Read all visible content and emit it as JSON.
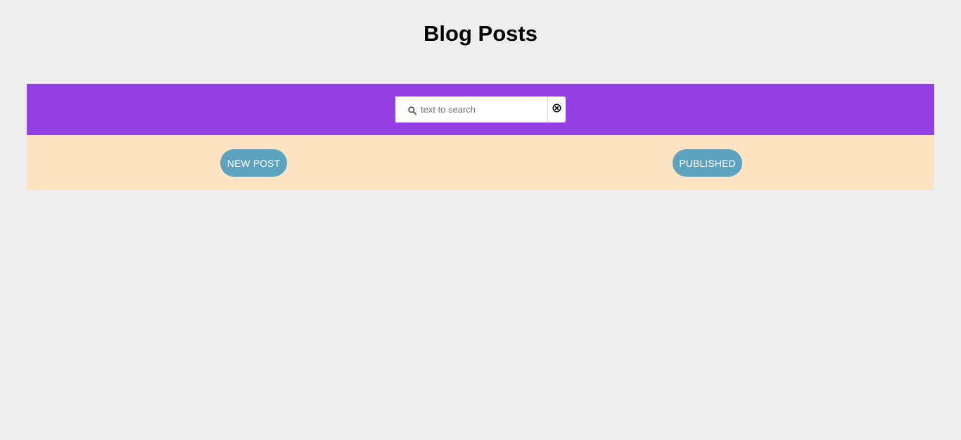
{
  "header": {
    "title": "Blog Posts"
  },
  "search": {
    "placeholder": "text to search",
    "value": "",
    "search_icon": "search-icon",
    "clear_icon": "circle-x-icon"
  },
  "actions": {
    "new_post_label": "NEW POST",
    "published_label": "PUBLISHED"
  },
  "colors": {
    "background": "#eeeeee",
    "search_band": "#9440e4",
    "action_band": "#ffe4c4",
    "button": "#5ba3bf",
    "button_text": "#ffffff"
  }
}
